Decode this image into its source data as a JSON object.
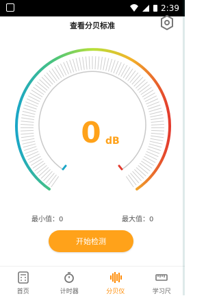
{
  "status": {
    "time": "2:39"
  },
  "header": {
    "title": "查看分贝标准"
  },
  "gauge": {
    "value": "0",
    "unit": "dB"
  },
  "stats": {
    "min_label": "最小值：0",
    "max_label": "最大值：0"
  },
  "actions": {
    "start_label": "开始检测"
  },
  "nav": {
    "items": [
      {
        "label": "首页",
        "icon": "calculator-icon"
      },
      {
        "label": "计时器",
        "icon": "stopwatch-icon"
      },
      {
        "label": "分贝仪",
        "icon": "waveform-icon"
      },
      {
        "label": "学习尺",
        "icon": "ruler-icon"
      }
    ],
    "active_index": 2
  },
  "colors": {
    "accent": "#ffa21a",
    "text": "#222222",
    "muted": "#666666"
  }
}
